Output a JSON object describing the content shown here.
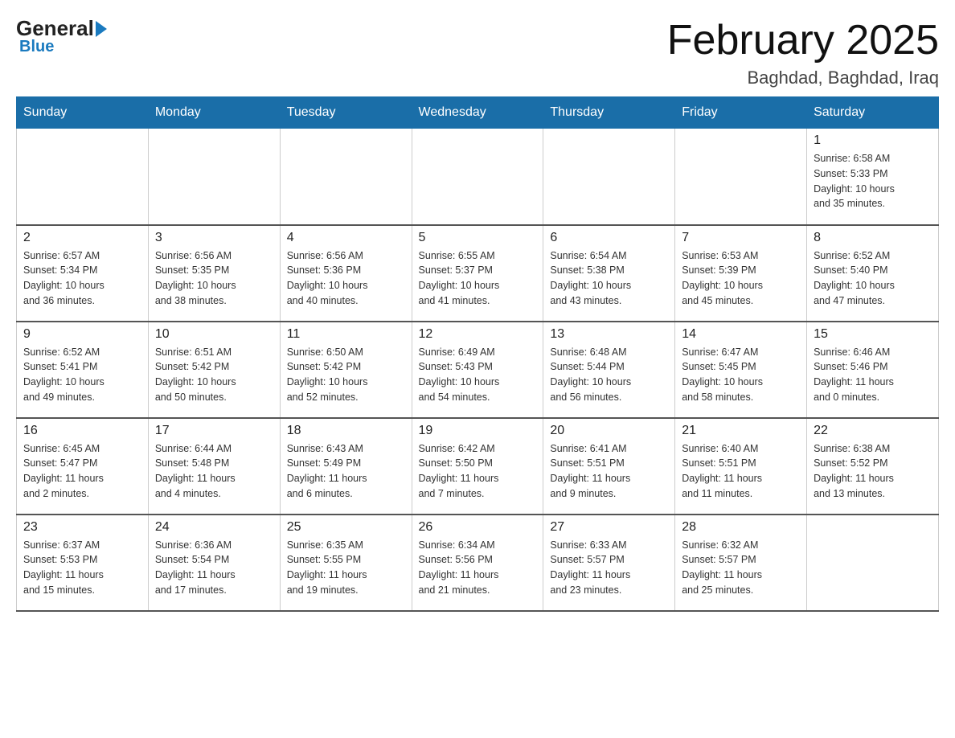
{
  "header": {
    "logo_text_general": "General",
    "logo_text_blue": "Blue",
    "main_title": "February 2025",
    "subtitle": "Baghdad, Baghdad, Iraq"
  },
  "calendar": {
    "days_of_week": [
      "Sunday",
      "Monday",
      "Tuesday",
      "Wednesday",
      "Thursday",
      "Friday",
      "Saturday"
    ],
    "weeks": [
      [
        {
          "day": "",
          "info": ""
        },
        {
          "day": "",
          "info": ""
        },
        {
          "day": "",
          "info": ""
        },
        {
          "day": "",
          "info": ""
        },
        {
          "day": "",
          "info": ""
        },
        {
          "day": "",
          "info": ""
        },
        {
          "day": "1",
          "info": "Sunrise: 6:58 AM\nSunset: 5:33 PM\nDaylight: 10 hours\nand 35 minutes."
        }
      ],
      [
        {
          "day": "2",
          "info": "Sunrise: 6:57 AM\nSunset: 5:34 PM\nDaylight: 10 hours\nand 36 minutes."
        },
        {
          "day": "3",
          "info": "Sunrise: 6:56 AM\nSunset: 5:35 PM\nDaylight: 10 hours\nand 38 minutes."
        },
        {
          "day": "4",
          "info": "Sunrise: 6:56 AM\nSunset: 5:36 PM\nDaylight: 10 hours\nand 40 minutes."
        },
        {
          "day": "5",
          "info": "Sunrise: 6:55 AM\nSunset: 5:37 PM\nDaylight: 10 hours\nand 41 minutes."
        },
        {
          "day": "6",
          "info": "Sunrise: 6:54 AM\nSunset: 5:38 PM\nDaylight: 10 hours\nand 43 minutes."
        },
        {
          "day": "7",
          "info": "Sunrise: 6:53 AM\nSunset: 5:39 PM\nDaylight: 10 hours\nand 45 minutes."
        },
        {
          "day": "8",
          "info": "Sunrise: 6:52 AM\nSunset: 5:40 PM\nDaylight: 10 hours\nand 47 minutes."
        }
      ],
      [
        {
          "day": "9",
          "info": "Sunrise: 6:52 AM\nSunset: 5:41 PM\nDaylight: 10 hours\nand 49 minutes."
        },
        {
          "day": "10",
          "info": "Sunrise: 6:51 AM\nSunset: 5:42 PM\nDaylight: 10 hours\nand 50 minutes."
        },
        {
          "day": "11",
          "info": "Sunrise: 6:50 AM\nSunset: 5:42 PM\nDaylight: 10 hours\nand 52 minutes."
        },
        {
          "day": "12",
          "info": "Sunrise: 6:49 AM\nSunset: 5:43 PM\nDaylight: 10 hours\nand 54 minutes."
        },
        {
          "day": "13",
          "info": "Sunrise: 6:48 AM\nSunset: 5:44 PM\nDaylight: 10 hours\nand 56 minutes."
        },
        {
          "day": "14",
          "info": "Sunrise: 6:47 AM\nSunset: 5:45 PM\nDaylight: 10 hours\nand 58 minutes."
        },
        {
          "day": "15",
          "info": "Sunrise: 6:46 AM\nSunset: 5:46 PM\nDaylight: 11 hours\nand 0 minutes."
        }
      ],
      [
        {
          "day": "16",
          "info": "Sunrise: 6:45 AM\nSunset: 5:47 PM\nDaylight: 11 hours\nand 2 minutes."
        },
        {
          "day": "17",
          "info": "Sunrise: 6:44 AM\nSunset: 5:48 PM\nDaylight: 11 hours\nand 4 minutes."
        },
        {
          "day": "18",
          "info": "Sunrise: 6:43 AM\nSunset: 5:49 PM\nDaylight: 11 hours\nand 6 minutes."
        },
        {
          "day": "19",
          "info": "Sunrise: 6:42 AM\nSunset: 5:50 PM\nDaylight: 11 hours\nand 7 minutes."
        },
        {
          "day": "20",
          "info": "Sunrise: 6:41 AM\nSunset: 5:51 PM\nDaylight: 11 hours\nand 9 minutes."
        },
        {
          "day": "21",
          "info": "Sunrise: 6:40 AM\nSunset: 5:51 PM\nDaylight: 11 hours\nand 11 minutes."
        },
        {
          "day": "22",
          "info": "Sunrise: 6:38 AM\nSunset: 5:52 PM\nDaylight: 11 hours\nand 13 minutes."
        }
      ],
      [
        {
          "day": "23",
          "info": "Sunrise: 6:37 AM\nSunset: 5:53 PM\nDaylight: 11 hours\nand 15 minutes."
        },
        {
          "day": "24",
          "info": "Sunrise: 6:36 AM\nSunset: 5:54 PM\nDaylight: 11 hours\nand 17 minutes."
        },
        {
          "day": "25",
          "info": "Sunrise: 6:35 AM\nSunset: 5:55 PM\nDaylight: 11 hours\nand 19 minutes."
        },
        {
          "day": "26",
          "info": "Sunrise: 6:34 AM\nSunset: 5:56 PM\nDaylight: 11 hours\nand 21 minutes."
        },
        {
          "day": "27",
          "info": "Sunrise: 6:33 AM\nSunset: 5:57 PM\nDaylight: 11 hours\nand 23 minutes."
        },
        {
          "day": "28",
          "info": "Sunrise: 6:32 AM\nSunset: 5:57 PM\nDaylight: 11 hours\nand 25 minutes."
        },
        {
          "day": "",
          "info": ""
        }
      ]
    ]
  }
}
